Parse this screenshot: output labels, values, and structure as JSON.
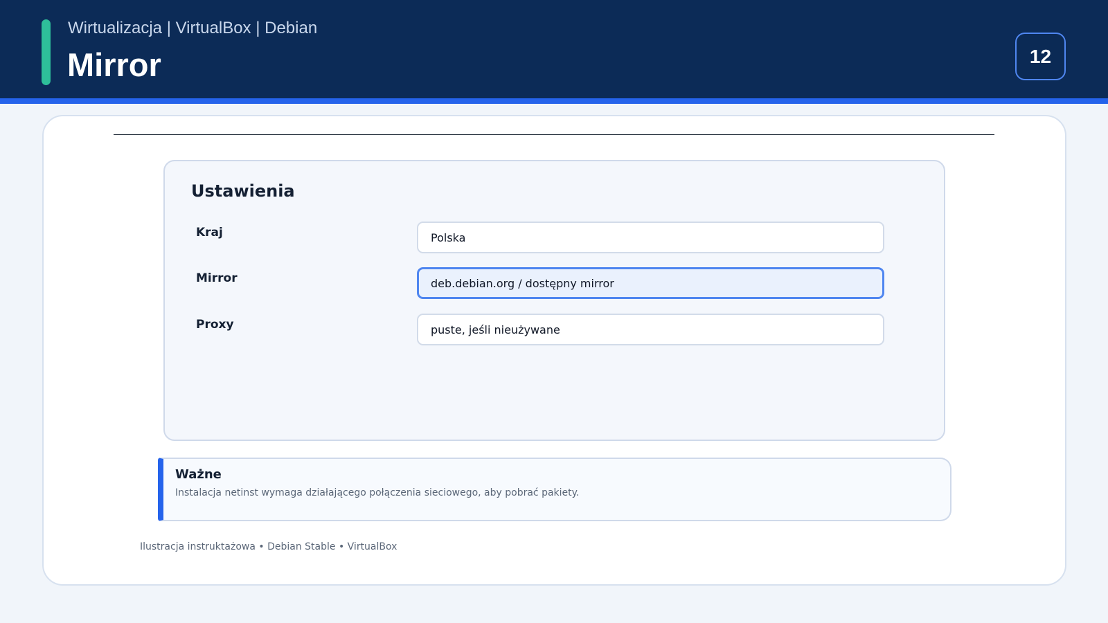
{
  "header": {
    "breadcrumb": "Wirtualizacja | VirtualBox | Debian",
    "title": "Mirror",
    "page_number": "12"
  },
  "settings": {
    "title": "Ustawienia",
    "fields": [
      {
        "label": "Kraj",
        "value": "Polska"
      },
      {
        "label": "Mirror",
        "value": "deb.debian.org / dostępny mirror"
      },
      {
        "label": "Proxy",
        "value": "puste, jeśli nieużywane"
      }
    ]
  },
  "note": {
    "title": "Ważne",
    "text": "Instalacja netinst wymaga działającego połączenia sieciowego, aby pobrać pakiety."
  },
  "footer": {
    "caption": "Ilustracja instruktażowa • Debian Stable • VirtualBox"
  },
  "colors": {
    "header_bg": "#0c2b57",
    "accent_blue": "#2563eb",
    "accent_green": "#2ebf9a",
    "page_bg": "#f1f5fa"
  }
}
